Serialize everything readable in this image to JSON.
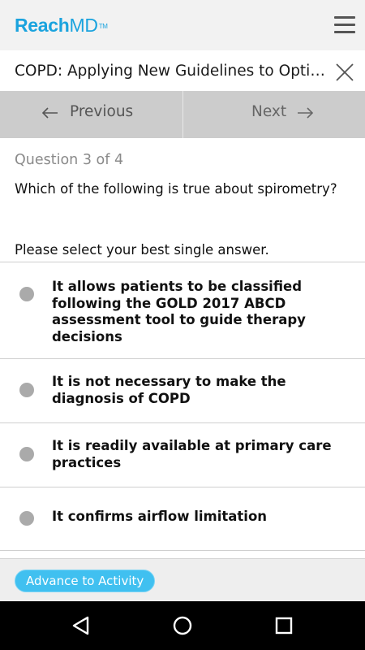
{
  "header": {
    "logo_reach": "Reach",
    "logo_md": "MD",
    "logo_tm": "TM",
    "menu_icon": "hamburger-menu-icon"
  },
  "activity": {
    "title": "COPD: Applying New Guidelines to Optimize Patient Care",
    "close_icon": "close-icon"
  },
  "navigation": {
    "previous_label": "Previous",
    "next_label": "Next",
    "previous_icon": "arrow-left-icon",
    "next_icon": "arrow-right-icon"
  },
  "question": {
    "counter": "Question 3 of 4",
    "text": "Which of the following is true about spirometry?",
    "instruction": "Please select your best single answer.",
    "options": [
      {
        "text": "It allows patients to be classified following the GOLD 2017 ABCD assessment tool to guide therapy decisions",
        "selected": false
      },
      {
        "text": "It is not necessary to make the diagnosis of COPD",
        "selected": false
      },
      {
        "text": "It is readily available at primary care practices",
        "selected": false
      },
      {
        "text": "It confirms airflow limitation",
        "selected": false
      }
    ]
  },
  "footer": {
    "advance_label": "Advance to Activity"
  },
  "system_nav": {
    "back_icon": "back-triangle-icon",
    "home_icon": "home-circle-icon",
    "recents_icon": "recents-square-icon"
  },
  "colors": {
    "brand": "#1aa3de",
    "advance_button": "#40c0f0",
    "nav_bar": "#cccccc",
    "radio": "#aaaaaa"
  }
}
